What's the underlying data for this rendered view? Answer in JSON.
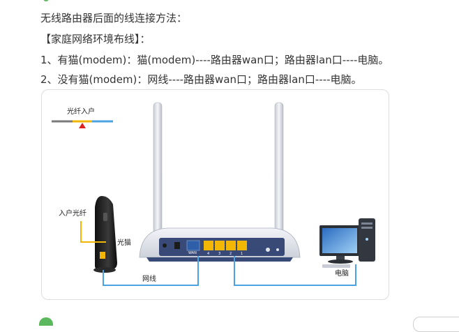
{
  "article": {
    "heading": "无线路由器后面的线连接方法：",
    "section_title": "【家庭网络环境布线】：",
    "item_1": "1、有猫(modem)：猫(modem)----路由器wan口；路由器lan口----电脑。",
    "item_2": "2、没有猫(modem)：网线----路由器wan口；路由器lan口----电脑。"
  },
  "figure": {
    "fiber_in_label": "光纤入户",
    "home_fiber_label": "入户光纤",
    "modem_label": "光猫",
    "cable_label": "网线",
    "computer_label": "电脑",
    "wan_port_label": "WAN",
    "lan_port_labels": [
      "4",
      "3",
      "2",
      "1"
    ],
    "colors": {
      "cable": "#4aa3e0",
      "fiber": "#f2b705",
      "lan_ports": "#f2b705",
      "wan_port": "#2f5fa8",
      "router_body": "#e6e8ee",
      "router_panel": "#2a3d6e",
      "arrow": "#e02020"
    }
  }
}
